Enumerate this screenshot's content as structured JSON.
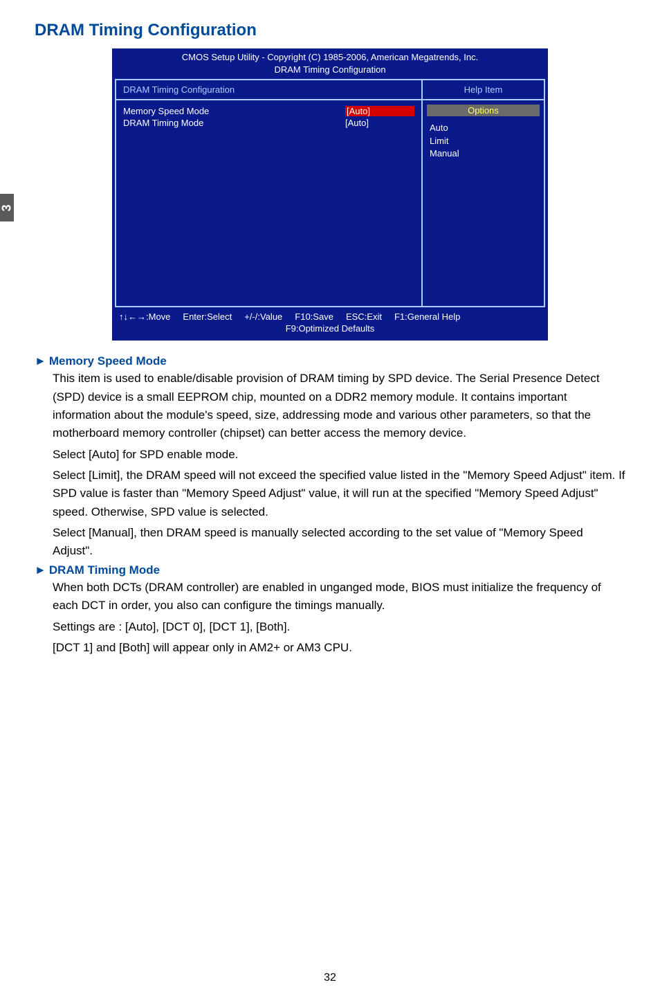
{
  "page_tab": "3",
  "page_title": "DRAM Timing Configuration",
  "bios": {
    "header_line1": "CMOS Setup Utility - Copyright (C) 1985-2006, American Megatrends, Inc.",
    "header_line2": "DRAM Timing Configuration",
    "section_title": "DRAM Timing Configuration",
    "help_title": "Help Item",
    "items": [
      {
        "label": "Memory Speed Mode",
        "value": "[Auto]",
        "highlighted": true
      },
      {
        "label": "DRAM Timing Mode",
        "value": "[Auto]",
        "highlighted": false
      }
    ],
    "options_header": "Options",
    "options": [
      "Auto",
      "Limit",
      "Manual"
    ],
    "footer": {
      "move": "↑↓←→:Move",
      "enter": "Enter:Select",
      "value": "+/-/:Value",
      "save": "F10:Save",
      "exit": "ESC:Exit",
      "help": "F1:General Help",
      "defaults": "F9:Optimized Defaults"
    }
  },
  "sections": [
    {
      "heading": "Memory Speed Mode",
      "paragraphs": [
        "This item is used to enable/disable provision of DRAM timing by SPD device. The Serial Presence Detect (SPD) device is a small EEPROM chip, mounted on a DDR2 memory module. It contains important information about the module's speed, size, addressing mode and various other parameters, so that the motherboard memory controller (chipset) can better access the memory device.",
        "Select [Auto] for SPD enable mode.",
        "Select [Limit], the DRAM speed will not exceed the specified value listed in the \"Memory Speed Adjust\" item. If SPD value is faster than \"Memory Speed Adjust\" value, it will run at the specified \"Memory Speed Adjust\" speed. Otherwise, SPD value is selected.",
        "Select [Manual], then DRAM speed is manually selected according to the set value of \"Memory Speed Adjust\"."
      ]
    },
    {
      "heading": "DRAM Timing Mode",
      "paragraphs": [
        "When both DCTs (DRAM controller) are enabled in unganged mode, BIOS must initialize the frequency of each DCT in order, you also can configure the timings manually.",
        "Settings are : [Auto], [DCT 0], [DCT 1], [Both].",
        "[DCT 1] and [Both] will appear only in AM2+ or AM3 CPU."
      ]
    }
  ],
  "page_number": "32"
}
